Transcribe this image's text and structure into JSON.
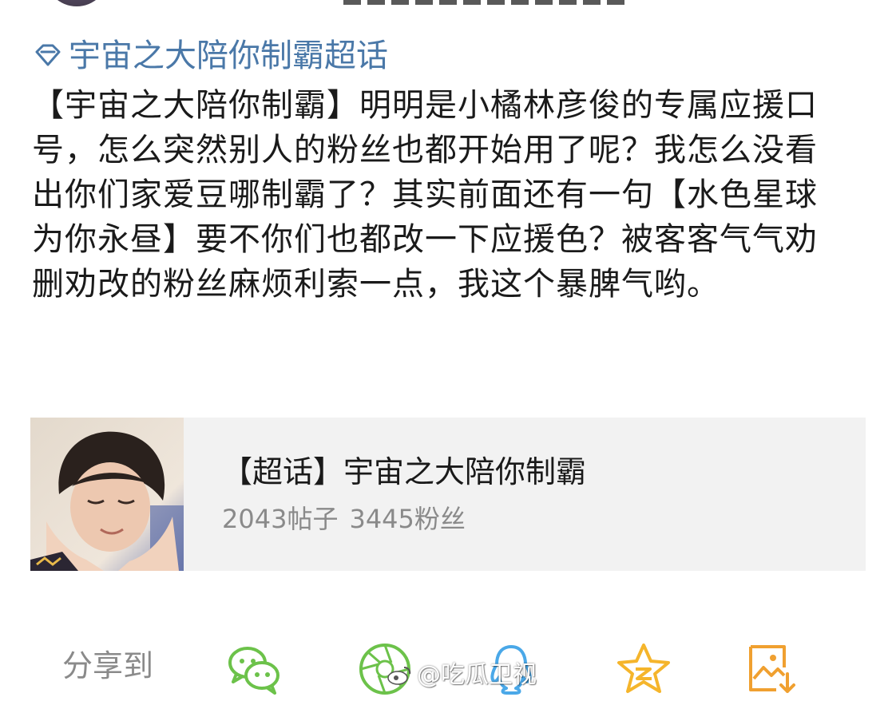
{
  "post": {
    "topic_link": "宇宙之大陪你制霸超话",
    "text": "【宇宙之大陪你制霸】明明是小橘林彦俊的专属应援口号，怎么突然别人的粉丝也都开始用了呢？我怎么没看出你们家爱豆哪制霸了？其实前面还有一句【水色星球为你永昼】要不你们也都改一下应援色？被客客气气劝删劝改的粉丝麻烦利索一点，我这个暴脾气哟。"
  },
  "topic_card": {
    "title": "【超话】宇宙之大陪你制霸",
    "posts": "2043帖子",
    "fans": "3445粉丝"
  },
  "share": {
    "label": "分享到",
    "icons": [
      {
        "name": "wechat-icon",
        "color": "#6cc24a"
      },
      {
        "name": "wechat-moments-icon",
        "color": "#6cc24a"
      },
      {
        "name": "qq-icon",
        "color": "#4aa8e8"
      },
      {
        "name": "qzone-icon",
        "color": "#f5b52b"
      },
      {
        "name": "save-image-icon",
        "color": "#f0a030"
      }
    ]
  },
  "watermark": {
    "text": "@吃瓜卫视"
  },
  "colors": {
    "link": "#4a78a8",
    "card_bg": "#f2f2f2",
    "muted": "#8a8a8a"
  }
}
